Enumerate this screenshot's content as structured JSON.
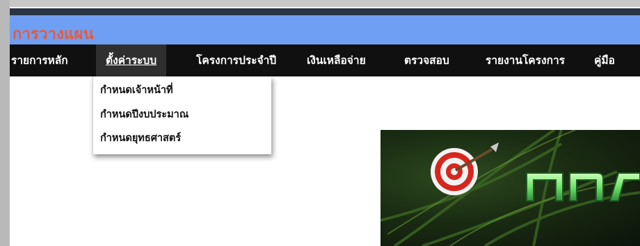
{
  "app": {
    "title": "การวางแผน"
  },
  "menu": {
    "items": [
      {
        "label": "รายการหลัก"
      },
      {
        "label": "ตั้งค่าระบบ"
      },
      {
        "label": "โครงการประจำปี"
      },
      {
        "label": "เงินเหลือจ่าย"
      },
      {
        "label": "ตรวจสอบ"
      },
      {
        "label": "รายงานโครงการ"
      },
      {
        "label": "คู่มือ"
      }
    ],
    "active_index": 1
  },
  "dropdown": {
    "items": [
      {
        "label": "กำหนดเจ้าหน้าที่"
      },
      {
        "label": "กำหนดปีงบประมาณ"
      },
      {
        "label": "กำหนดยุทธศาสตร์"
      }
    ]
  },
  "banner": {
    "icon": "target-with-arrow-icon",
    "logo_text_partial": "การ"
  },
  "colors": {
    "titlebar": "#6f9ff2",
    "title_text": "#e85a3b",
    "menubar": "#101010",
    "active_menu": "#2f2f2f",
    "banner_logo": "#6fe36a"
  }
}
